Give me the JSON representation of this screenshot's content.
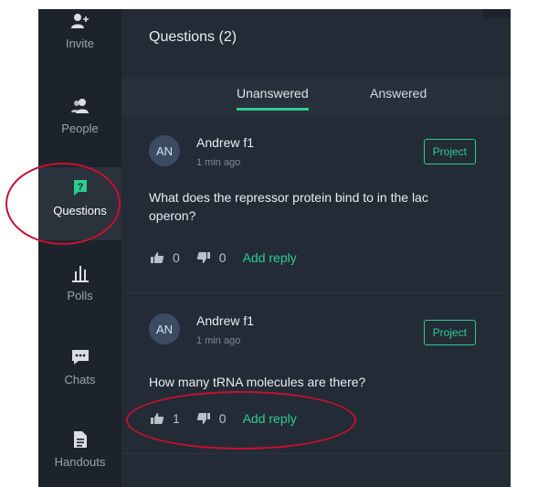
{
  "sidebar": {
    "items": [
      {
        "label": "Invite",
        "icon": "invite-icon"
      },
      {
        "label": "People",
        "icon": "people-icon"
      },
      {
        "label": "Questions",
        "icon": "question-icon"
      },
      {
        "label": "Polls",
        "icon": "polls-icon"
      },
      {
        "label": "Chats",
        "icon": "chats-icon"
      },
      {
        "label": "Handouts",
        "icon": "handouts-icon"
      }
    ]
  },
  "header": {
    "title": "Questions (2)"
  },
  "tabs": [
    {
      "label": "Unanswered"
    },
    {
      "label": "Answered"
    }
  ],
  "questions": [
    {
      "initials": "AN",
      "author": "Andrew f1",
      "time": "1 min ago",
      "badge": "Project",
      "text": "What does the repressor protein bind to in the lac operon?",
      "upvotes": "0",
      "downvotes": "0",
      "reply_label": "Add reply"
    },
    {
      "initials": "AN",
      "author": "Andrew f1",
      "time": "1 min ago",
      "badge": "Project",
      "text": "How many tRNA molecules are there?",
      "upvotes": "1",
      "downvotes": "0",
      "reply_label": "Add reply"
    }
  ],
  "colors": {
    "accent": "#2ecc8f",
    "background": "#232b36",
    "sidebar": "#1c232c",
    "annotation": "#c8102e"
  }
}
